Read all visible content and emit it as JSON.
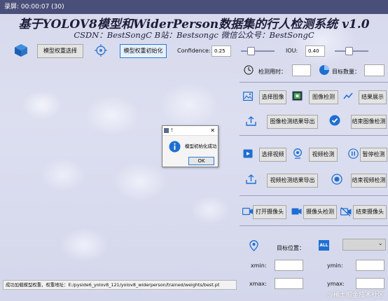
{
  "window": {
    "title": "录屏: 00:00:07 (30)"
  },
  "header": {
    "title": "基于YOLOV8模型和WiderPerson数据集的行人检测系统 v1.0",
    "subtitle": "CSDN：BestSongC   B站：Bestsongc   微信公众号：BestSongC"
  },
  "toolbar": {
    "select_weights": "模型权重选择",
    "init_weights": "模型权重初始化",
    "confidence_label": "Confidence:",
    "confidence_value": "0.25",
    "iou_label": "IOU:",
    "iou_value": "0.40",
    "confidence_level": 0.25,
    "iou_level": 0.4
  },
  "stats": {
    "time_label": "检测用时：",
    "count_label": "目标数量："
  },
  "image_section": {
    "select": "选择图像",
    "detect": "图像检测",
    "show_result": "结果展示",
    "export": "图像检测结果导出",
    "end": "结束图像检测"
  },
  "video_section": {
    "select": "选择视频",
    "detect": "视频检测",
    "pause": "暂停检测",
    "export": "视频检测结果导出",
    "end": "结束视频检测"
  },
  "camera_section": {
    "open": "打开摄像头",
    "detect": "摄像头检测",
    "end": "结束摄像头"
  },
  "target": {
    "position_label": "目标位置：",
    "xmin": "xmin:",
    "ymin": "ymin:",
    "xmax": "xmax:",
    "ymax": "ymax:",
    "all_badge": "ALL"
  },
  "status_bar": "成功加载模型权重，权重地址：E:/pyside6_yolov8_121/yolov8_widerperson/trained/weights/best.pt",
  "dialog": {
    "title": "!",
    "message": "模型初始化成功",
    "ok": "OK"
  },
  "watermark": "@稀土掘金技术社区",
  "colors": {
    "accent": "#2a7ad6",
    "icon_blue": "#1f6fd1"
  }
}
